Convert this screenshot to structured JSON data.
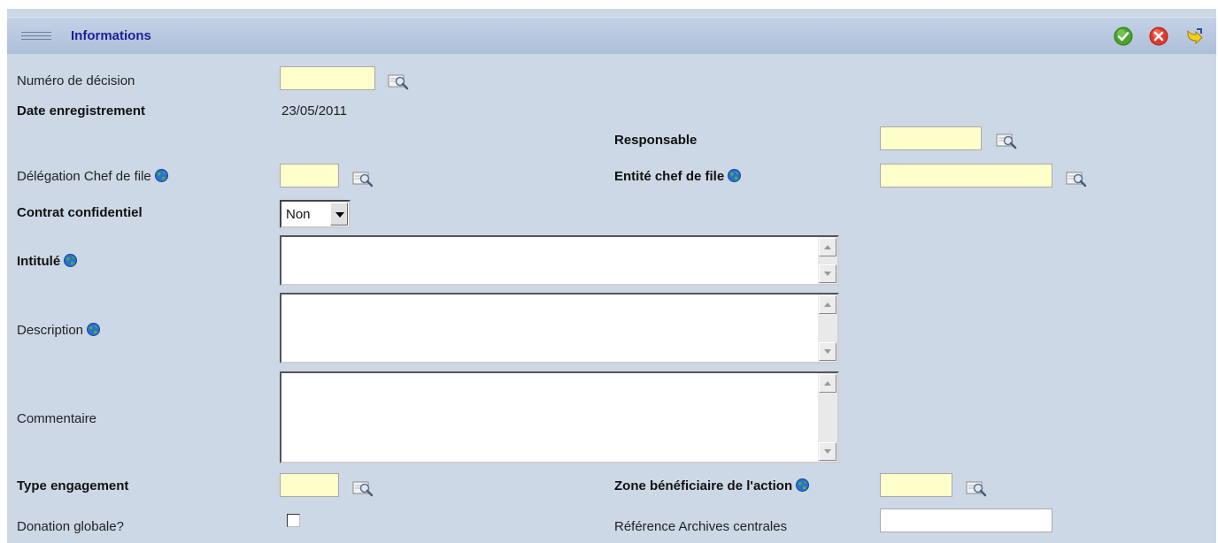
{
  "header": {
    "title": "Informations",
    "icons": [
      "menu-grip-icon",
      "validate-check-icon",
      "cancel-x-icon",
      "exit-arrow-icon"
    ]
  },
  "colors": {
    "panel": "#cdd8e6",
    "header": "#b6c6dd",
    "title": "#1d1d9b",
    "required_input": "#ffffcc",
    "validate": "#4aa32d",
    "cancel": "#e03a2c",
    "exit": "#e8c400"
  },
  "form": {
    "numero_decision": {
      "label": "Numéro de décision",
      "value": ""
    },
    "date_enregistrement": {
      "label": "Date enregistrement",
      "value": "23/05/2011"
    },
    "responsable": {
      "label": "Responsable",
      "value": ""
    },
    "delegation_chef": {
      "label": "Délégation Chef de file",
      "value": ""
    },
    "entite_chef": {
      "label": "Entité chef de file",
      "value": ""
    },
    "contrat_confidentiel": {
      "label": "Contrat confidentiel",
      "value": "Non"
    },
    "intitule": {
      "label": "Intitulé",
      "value": ""
    },
    "description": {
      "label": "Description",
      "value": ""
    },
    "commentaire": {
      "label": "Commentaire",
      "value": ""
    },
    "type_engagement": {
      "label": "Type engagement",
      "value": ""
    },
    "zone_beneficiaire": {
      "label": "Zone bénéficiaire de l'action",
      "value": ""
    },
    "donation_globale": {
      "label": "Donation globale?",
      "checked": false
    },
    "reference_archives": {
      "label": "Référence Archives centrales",
      "value": ""
    }
  }
}
